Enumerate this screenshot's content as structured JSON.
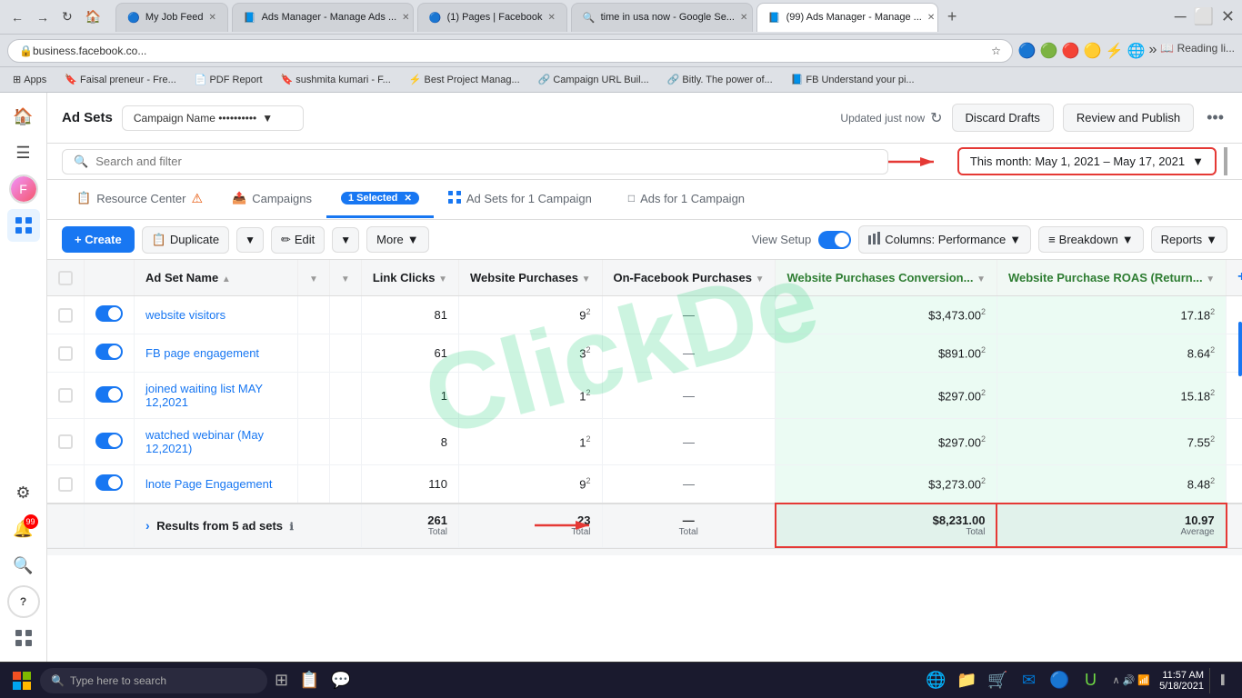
{
  "browser": {
    "tabs": [
      {
        "id": "t1",
        "label": "My Job Feed",
        "favicon": "🔵",
        "active": false
      },
      {
        "id": "t2",
        "label": "Ads Manager - Manage Ads ...",
        "favicon": "📘",
        "active": false
      },
      {
        "id": "t3",
        "label": "(1) Pages | Facebook",
        "favicon": "🔵",
        "active": false
      },
      {
        "id": "t4",
        "label": "time in usa now - Google Se...",
        "favicon": "🔍",
        "active": false
      },
      {
        "id": "t5",
        "label": "(99) Ads Manager - Manage ...",
        "favicon": "📘",
        "active": true
      }
    ],
    "address": "business.facebook.co...",
    "bookmarks": [
      {
        "label": "Apps"
      },
      {
        "label": "Faisal preneur - Fre..."
      },
      {
        "label": "PDF Report"
      },
      {
        "label": "sushmita kumari - F..."
      },
      {
        "label": "Best Project Manag..."
      },
      {
        "label": "Campaign URL Buil..."
      },
      {
        "label": "Bitly. The power of..."
      },
      {
        "label": "FB Understand your pi..."
      }
    ]
  },
  "topbar": {
    "ad_sets_label": "Ad Sets",
    "campaign_name": "Campaign Name ••••••••••",
    "updated_text": "Updated just now",
    "discard_label": "Discard Drafts",
    "review_publish_label": "Review and Publish",
    "more_icon": "•••"
  },
  "date_filter": {
    "search_placeholder": "Search and filter",
    "date_range": "This month: May 1, 2021 – May 17, 2021"
  },
  "nav": {
    "resource_center": "Resource Center",
    "campaigns": "Campaigns",
    "selected_count": "1 Selected",
    "ad_sets_for": "Ad Sets for 1 Campaign",
    "ads_for": "Ads for 1 Campaign"
  },
  "toolbar": {
    "create_label": "+ Create",
    "duplicate_label": "Duplicate",
    "edit_label": "Edit",
    "more_label": "More",
    "view_setup_label": "View Setup",
    "columns_label": "Columns: Performance",
    "breakdown_label": "Breakdown",
    "reports_label": "Reports"
  },
  "table": {
    "headers": [
      {
        "key": "checkbox",
        "label": ""
      },
      {
        "key": "toggle",
        "label": ""
      },
      {
        "key": "name",
        "label": "Ad Set Name"
      },
      {
        "key": "sort1",
        "label": ""
      },
      {
        "key": "sort2",
        "label": ""
      },
      {
        "key": "link_clicks",
        "label": "Link Clicks"
      },
      {
        "key": "website_purchases",
        "label": "Website Purchases"
      },
      {
        "key": "on_fb",
        "label": "On-Facebook Purchases"
      },
      {
        "key": "website_conv",
        "label": "Website Purchases Conversion..."
      },
      {
        "key": "roas",
        "label": "Website Purchase ROAS (Return..."
      },
      {
        "key": "plus",
        "label": "+"
      }
    ],
    "rows": [
      {
        "id": 1,
        "toggle": true,
        "name": "website visitors",
        "link_clicks": "81",
        "website_purchases": "9",
        "website_purchases_sup": "2",
        "on_fb": "—",
        "website_conv": "$3,473.00",
        "website_conv_sup": "2",
        "roas": "17.18",
        "roas_sup": "2"
      },
      {
        "id": 2,
        "toggle": true,
        "name": "FB page engagement",
        "link_clicks": "61",
        "website_purchases": "3",
        "website_purchases_sup": "2",
        "on_fb": "—",
        "website_conv": "$891.00",
        "website_conv_sup": "2",
        "roas": "8.64",
        "roas_sup": "2"
      },
      {
        "id": 3,
        "toggle": true,
        "name": "joined waiting list MAY 12,2021",
        "link_clicks": "1",
        "website_purchases": "1",
        "website_purchases_sup": "2",
        "on_fb": "—",
        "website_conv": "$297.00",
        "website_conv_sup": "2",
        "roas": "15.18",
        "roas_sup": "2"
      },
      {
        "id": 4,
        "toggle": true,
        "name": "watched webinar (May 12,2021)",
        "link_clicks": "8",
        "website_purchases": "1",
        "website_purchases_sup": "2",
        "on_fb": "—",
        "website_conv": "$297.00",
        "website_conv_sup": "2",
        "roas": "7.55",
        "roas_sup": "2"
      },
      {
        "id": 5,
        "toggle": true,
        "name": "lnote Page Engagement",
        "link_clicks": "110",
        "website_purchases": "9",
        "website_purchases_sup": "2",
        "on_fb": "—",
        "website_conv": "$3,273.00",
        "website_conv_sup": "2",
        "roas": "8.48",
        "roas_sup": "2"
      }
    ],
    "total_row": {
      "expand_label": "Results from 5 ad sets",
      "link_clicks": "261",
      "link_clicks_sub": "Total",
      "website_purchases": "23",
      "website_purchases_sub": "Total",
      "on_fb": "—",
      "on_fb_sub": "Total",
      "website_conv": "$8,231.00",
      "website_conv_sub": "Total",
      "roas": "10.97",
      "roas_sub": "Average"
    }
  },
  "watermark": "ClickDe",
  "sidebar": {
    "icons": [
      {
        "name": "home",
        "symbol": "🏠",
        "active": false
      },
      {
        "name": "menu",
        "symbol": "☰",
        "active": false
      },
      {
        "name": "avatar",
        "symbol": "👤",
        "active": false
      },
      {
        "name": "grid",
        "symbol": "⊞",
        "active": true
      },
      {
        "name": "settings",
        "symbol": "⚙",
        "active": false
      },
      {
        "name": "notifications",
        "symbol": "🔔",
        "active": false,
        "badge": "99"
      },
      {
        "name": "search",
        "symbol": "🔍",
        "active": false
      },
      {
        "name": "help",
        "symbol": "?",
        "active": false
      },
      {
        "name": "plus-square",
        "symbol": "⊞",
        "active": false
      }
    ]
  },
  "taskbar": {
    "search_placeholder": "Type here to search",
    "time": "11:57 AM",
    "date": "5/18/2021"
  }
}
